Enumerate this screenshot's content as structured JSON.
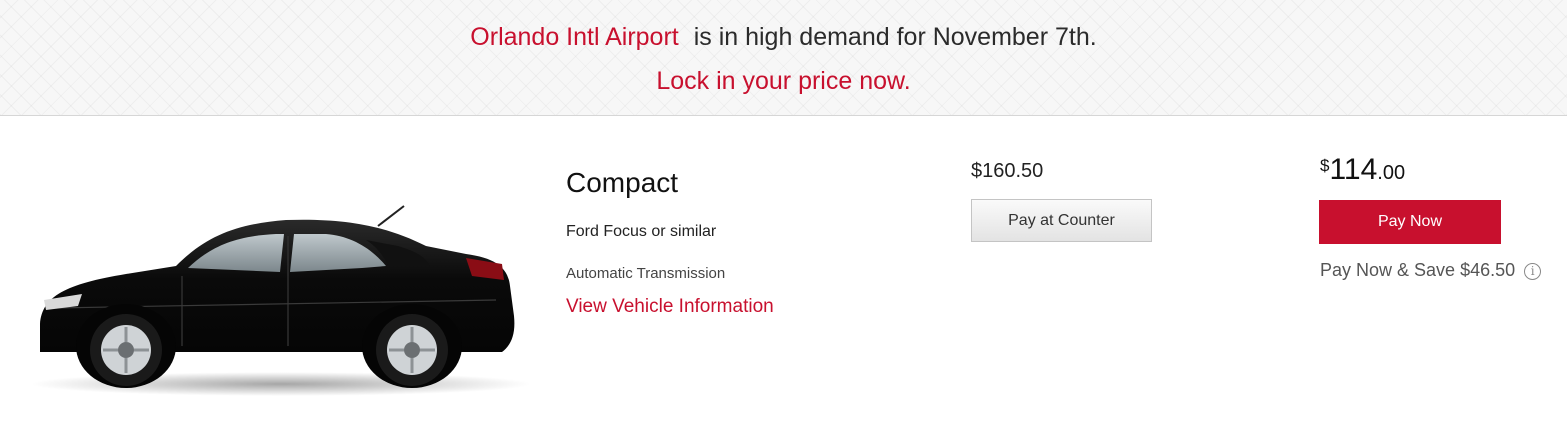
{
  "banner": {
    "location": "Orlando Intl Airport",
    "demand_text": "is in high demand for November 7th.",
    "cta": "Lock in your price now."
  },
  "vehicle": {
    "class": "Compact",
    "model": "Ford Focus or similar",
    "transmission": "Automatic Transmission",
    "info_link": "View Vehicle Information",
    "image_icon": "black-sedan-car-image",
    "color": "#0d0d0d"
  },
  "pay_counter": {
    "price": "$160.50",
    "button_label": "Pay at Counter"
  },
  "pay_now": {
    "currency": "$",
    "whole": "114",
    "cents": ".00",
    "button_label": "Pay Now",
    "savings": "Pay Now & Save $46.50",
    "info_icon": "info-icon"
  },
  "colors": {
    "brand_red": "#c8102e",
    "banner_bg": "#f7f7f7"
  }
}
